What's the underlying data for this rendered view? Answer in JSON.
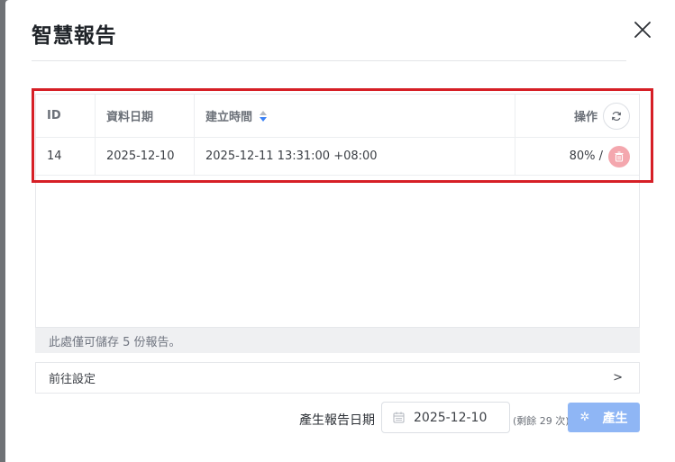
{
  "modal": {
    "title": "智慧報告"
  },
  "table": {
    "columns": {
      "id": "ID",
      "data_date": "資料日期",
      "created_at": "建立時間",
      "actions": "操作"
    },
    "rows": [
      {
        "id": "14",
        "data_date": "2025-12-10",
        "created_at": "2025-12-11 13:31:00 +08:00",
        "status": "80% /"
      }
    ],
    "sort_active": "created_at",
    "sort_direction": "desc",
    "footnote": "此處僅可儲存 5 份報告。"
  },
  "settings": {
    "label": "前往設定",
    "chevron": ">"
  },
  "generate": {
    "label": "產生報告日期",
    "date_value": "2025-12-10",
    "remaining": "(剩餘 29 次)",
    "button_label": "產生"
  },
  "colors": {
    "accent": "#3b82f6",
    "highlight_border": "#d61f26",
    "danger_soft": "#f4a7ae",
    "button_disabled": "#8fb6f5"
  },
  "icons": {
    "close": "close-icon",
    "sort": "sort-icon",
    "refresh": "refresh-icon",
    "delete": "trash-icon",
    "calendar": "calendar-icon",
    "spinner": "spinner-icon"
  }
}
